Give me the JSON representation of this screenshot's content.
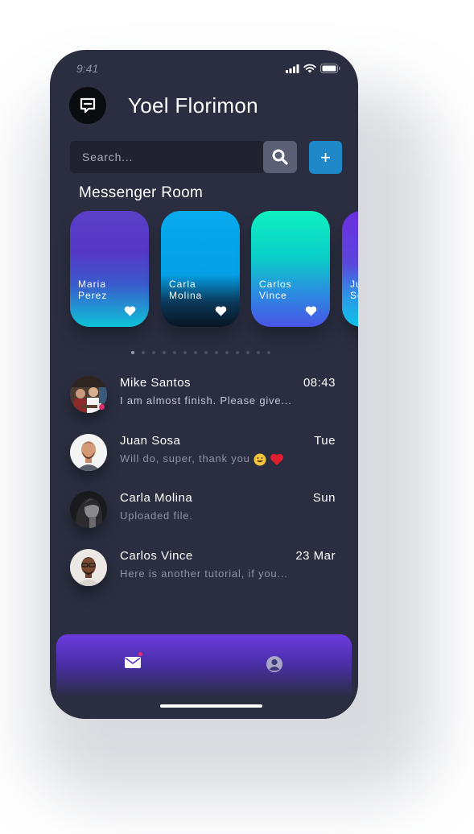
{
  "status_bar": {
    "time": "9:41"
  },
  "header": {
    "user_name": "Yoel Florimon",
    "logo_icon": "chat-bubble-icon"
  },
  "search": {
    "placeholder": "Search...",
    "value": "",
    "button_icon": "search-icon"
  },
  "add_button": {
    "label": "+"
  },
  "rooms": {
    "title": "Messenger Room",
    "cards": [
      {
        "name_line1": "Maria",
        "name_line2": "Perez",
        "gradient": [
          "#5a3fc8",
          "#0ec3d8"
        ]
      },
      {
        "name_line1": "Carla",
        "name_line2": "Molina",
        "gradient": [
          "#08a9ee",
          "#081520"
        ]
      },
      {
        "name_line1": "Carlos",
        "name_line2": "Vince",
        "gradient": [
          "#0ef0c0",
          "#4a55e8"
        ]
      },
      {
        "name_line1": "Ju",
        "name_line2": "So",
        "gradient": [
          "#6a2fe0",
          "#0ec3e8"
        ]
      }
    ],
    "pagination": {
      "total": 14,
      "active_index": 0
    }
  },
  "chats": [
    {
      "name": "Mike Santos",
      "time": "08:43",
      "message": "I am almost finish. Please give...",
      "unread": true
    },
    {
      "name": "Juan Sosa",
      "time": "Tue",
      "message": "Will do, super, thank you",
      "emojis": [
        "grinning-face-emoji",
        "red-heart-emoji"
      ]
    },
    {
      "name": "Carla Molina",
      "time": "Sun",
      "message": "Uploaded file."
    },
    {
      "name": "Carlos Vince",
      "time": "23 Mar",
      "message": "Here is another tutorial, if you..."
    }
  ],
  "bottom_nav": {
    "items": [
      "mail-icon",
      "profile-icon"
    ],
    "active": "mail-icon"
  },
  "colors": {
    "phone_bg": "#2a2e40",
    "accent_blue": "#1e88c8",
    "accent_purple": "#6c3be0",
    "notification": "#e52b6e"
  }
}
